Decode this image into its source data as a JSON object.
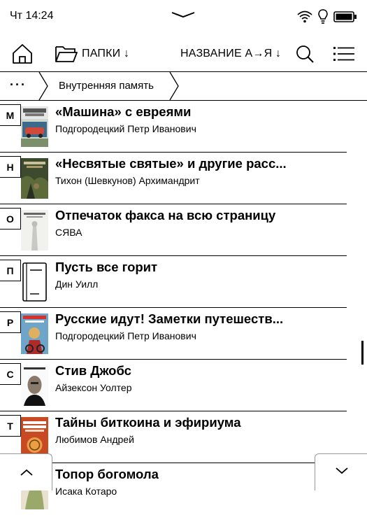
{
  "status": {
    "time": "Чт 14:24"
  },
  "toolbar": {
    "folders_label": "ПАПКИ ↓",
    "sort_label": "НАЗВАНИЕ А→Я ↓"
  },
  "breadcrumb": {
    "dots": "···",
    "location": "Внутренняя память"
  },
  "books": [
    {
      "letter": "М",
      "title": "«Машина» с евреями",
      "author": "Подгородецкий Петр Иванович"
    },
    {
      "letter": "Н",
      "title": "«Несвятые святые» и другие расс...",
      "author": "Тихон (Шевкунов) Архимандрит"
    },
    {
      "letter": "О",
      "title": "Отпечаток факса на всю страницу",
      "author": "СЯВА"
    },
    {
      "letter": "П",
      "title": "Пусть все горит",
      "author": "Дин Уилл"
    },
    {
      "letter": "Р",
      "title": "Русские идут! Заметки путешеств...",
      "author": "Подгородецкий Петр Иванович"
    },
    {
      "letter": "С",
      "title": "Стив Джобс",
      "author": "Айзексон Уолтер"
    },
    {
      "letter": "Т",
      "title": "Тайны биткоина и эфириума",
      "author": "Любимов Андрей"
    },
    {
      "letter": "",
      "title": "Топор богомола",
      "author": "Исака Котаро"
    }
  ],
  "colors": {
    "ink": "#000000",
    "paper": "#ffffff"
  }
}
